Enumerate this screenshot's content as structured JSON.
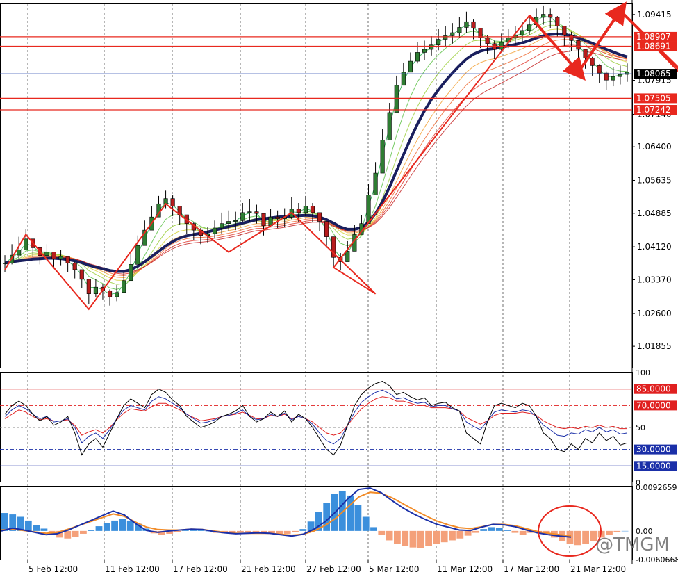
{
  "watermark": "@TMGM",
  "x_labels": [
    "5 Feb 12:00",
    "11 Feb 12:00",
    "17 Feb 12:00",
    "21 Feb 12:00",
    "27 Feb 12:00",
    "5 Mar 12:00",
    "11 Mar 12:00",
    "17 Mar 12:00",
    "21 Mar 12:00"
  ],
  "price_ticks": [
    "1.09415",
    "1.07915",
    "1.07140",
    "1.06400",
    "1.05635",
    "1.04885",
    "1.04120",
    "1.03370",
    "1.02600",
    "1.01855"
  ],
  "levels": {
    "red": [
      "1.08907",
      "1.08691",
      "1.07505",
      "1.07242"
    ],
    "current": "1.08065"
  },
  "rsi_ticks": [
    "100",
    "50",
    "0"
  ],
  "rsi_levels": {
    "red": [
      "85.0000",
      "70.0000"
    ],
    "blue": [
      "30.0000",
      "15.0000"
    ]
  },
  "macd_ticks": [
    "0.0092659",
    "0.00",
    "-0.0060668"
  ],
  "colors": {
    "up_candle": "#2e7d32",
    "down_candle": "#b71c1c",
    "ma_thick": "#1a1f5e",
    "annotation": "#e8281e",
    "hist_pos": "#3b8fdc",
    "hist_neg": "#f4a07a",
    "macd_line": "#1a2fa8",
    "signal_line": "#f28c28",
    "grid": "#000000",
    "background": "#ffffff"
  },
  "chart_data": {
    "type": "candlestick",
    "price_panel": {
      "ylim": [
        1.0135,
        1.0965
      ],
      "candles": {
        "close": [
          1.0375,
          1.0393,
          1.0405,
          1.043,
          1.041,
          1.0392,
          1.04,
          1.0385,
          1.039,
          1.0375,
          1.036,
          1.0338,
          1.0305,
          1.032,
          1.0312,
          1.0298,
          1.0308,
          1.0335,
          1.0372,
          1.0415,
          1.045,
          1.048,
          1.051,
          1.0522,
          1.0505,
          1.0485,
          1.0465,
          1.045,
          1.0438,
          1.0442,
          1.0455,
          1.0465,
          1.047,
          1.0472,
          1.049,
          1.0492,
          1.0488,
          1.046,
          1.048,
          1.0476,
          1.048,
          1.0498,
          1.049,
          1.0505,
          1.049,
          1.047,
          1.0435,
          1.0388,
          1.0378,
          1.0402,
          1.044,
          1.0465,
          1.053,
          1.058,
          1.0655,
          1.0718,
          1.078,
          1.081,
          1.0835,
          1.0855,
          1.0862,
          1.0872,
          1.0885,
          1.0893,
          1.09,
          1.0912,
          1.0925,
          1.091,
          1.0888,
          1.0875,
          1.0862,
          1.0878,
          1.0888,
          1.0895,
          1.0905,
          1.0918,
          1.0935,
          1.0942,
          1.0935,
          1.0915,
          1.0895,
          1.0882,
          1.0862,
          1.0842,
          1.0825,
          1.0808,
          1.0792,
          1.08,
          1.0805,
          1.081
        ],
        "high": [
          1.0393,
          1.0418,
          1.0435,
          1.0452,
          1.0428,
          1.0405,
          1.0418,
          1.04,
          1.0405,
          1.039,
          1.0378,
          1.0355,
          1.0325,
          1.0338,
          1.0328,
          1.0315,
          1.0325,
          1.0355,
          1.0395,
          1.0438,
          1.0472,
          1.0505,
          1.0528,
          1.054,
          1.053,
          1.0505,
          1.0485,
          1.0468,
          1.0455,
          1.0458,
          1.0472,
          1.049,
          1.0495,
          1.0492,
          1.0512,
          1.052,
          1.0508,
          1.0485,
          1.0498,
          1.0495,
          1.05,
          1.0525,
          1.0512,
          1.0528,
          1.0512,
          1.049,
          1.0458,
          1.041,
          1.0398,
          1.0425,
          1.0462,
          1.0485,
          1.0555,
          1.0605,
          1.068,
          1.074,
          1.0802,
          1.0832,
          1.0855,
          1.0878,
          1.0882,
          1.0892,
          1.0908,
          1.0915,
          1.0922,
          1.0935,
          1.0948,
          1.093,
          1.091,
          1.0895,
          1.0882,
          1.0898,
          1.0908,
          1.0915,
          1.0925,
          1.0938,
          1.0955,
          1.0962,
          1.0955,
          1.0938,
          1.0915,
          1.0902,
          1.0882,
          1.0862,
          1.0845,
          1.0828,
          1.0812,
          1.0822,
          1.0825,
          1.083
        ],
        "low": [
          1.0355,
          1.0372,
          1.0382,
          1.0408,
          1.0388,
          1.0372,
          1.038,
          1.0365,
          1.037,
          1.0355,
          1.034,
          1.0318,
          1.0282,
          1.0298,
          1.0292,
          1.0278,
          1.0288,
          1.0315,
          1.035,
          1.0395,
          1.0428,
          1.0458,
          1.0488,
          1.05,
          1.0482,
          1.0462,
          1.0442,
          1.0428,
          1.0418,
          1.0422,
          1.0432,
          1.0442,
          1.0448,
          1.045,
          1.0468,
          1.047,
          1.0465,
          1.0438,
          1.0458,
          1.0455,
          1.0458,
          1.0475,
          1.0468,
          1.0482,
          1.0468,
          1.0448,
          1.041,
          1.0365,
          1.0358,
          1.038,
          1.0418,
          1.0442,
          1.0505,
          1.0555,
          1.063,
          1.0692,
          1.0755,
          1.0785,
          1.081,
          1.083,
          1.0838,
          1.0848,
          1.086,
          1.0868,
          1.0875,
          1.0888,
          1.09,
          1.0885,
          1.0865,
          1.0852,
          1.084,
          1.0855,
          1.0865,
          1.0872,
          1.088,
          1.0895,
          1.091,
          1.0918,
          1.091,
          1.089,
          1.087,
          1.0858,
          1.0838,
          1.0818,
          1.0802,
          1.0785,
          1.077,
          1.0778,
          1.0782,
          1.0788
        ]
      },
      "ma_thick": [
        1.0375,
        1.0378,
        1.038,
        1.0382,
        1.0384,
        1.0385,
        1.0386,
        1.0386,
        1.0385,
        1.0383,
        1.038,
        1.0376,
        1.037,
        1.0366,
        1.0362,
        1.0358,
        1.0356,
        1.0356,
        1.036,
        1.0368,
        1.0378,
        1.039,
        1.0402,
        1.0414,
        1.0424,
        1.0432,
        1.0437,
        1.044,
        1.0443,
        1.0446,
        1.045,
        1.0454,
        1.0458,
        1.0462,
        1.0466,
        1.047,
        1.0474,
        1.0476,
        1.0478,
        1.048,
        1.0481,
        1.0482,
        1.0483,
        1.0484,
        1.0483,
        1.048,
        1.0474,
        1.0466,
        1.0457,
        1.0452,
        1.0452,
        1.0456,
        1.0468,
        1.0488,
        1.0515,
        1.0548,
        1.0585,
        1.0622,
        1.0658,
        1.0692,
        1.0722,
        1.0748,
        1.077,
        1.079,
        1.0808,
        1.0825,
        1.084,
        1.0851,
        1.0858,
        1.0862,
        1.0864,
        1.0867,
        1.087,
        1.0873,
        1.0877,
        1.0882,
        1.0888,
        1.0893,
        1.0896,
        1.0897,
        1.0896,
        1.0893,
        1.0888,
        1.0882,
        1.0876,
        1.0869,
        1.0862,
        1.0856,
        1.085,
        1.0845
      ],
      "annotation_zigzag": [
        [
          0,
          1.036
        ],
        [
          3,
          1.044
        ],
        [
          12,
          1.027
        ],
        [
          23,
          1.051
        ],
        [
          32,
          1.04
        ],
        [
          41,
          1.049
        ],
        [
          53,
          1.0305
        ],
        [
          47,
          1.0365
        ],
        [
          75,
          1.0939
        ],
        [
          82,
          1.0813
        ],
        [
          88,
          1.095
        ],
        [
          100,
          1.075
        ]
      ],
      "annotation_arrows": [
        [
          [
            75,
            1.0939
          ],
          [
            82,
            1.081
          ]
        ],
        [
          [
            82,
            1.081
          ],
          [
            88,
            1.095
          ]
        ],
        [
          [
            88,
            1.095
          ],
          [
            101,
            1.0745
          ]
        ],
        [
          [
            101,
            1.0745
          ],
          [
            104,
            1.0805
          ]
        ],
        [
          [
            104,
            1.0805
          ],
          [
            107,
            1.0755
          ]
        ]
      ]
    },
    "rsi_panel": {
      "ylim": [
        0,
        100
      ],
      "rsi_fast": [
        62,
        70,
        74,
        70,
        62,
        56,
        60,
        52,
        55,
        60,
        45,
        25,
        35,
        40,
        32,
        45,
        58,
        70,
        76,
        72,
        68,
        80,
        85,
        82,
        75,
        70,
        60,
        55,
        50,
        52,
        55,
        60,
        62,
        65,
        70,
        60,
        55,
        58,
        64,
        60,
        65,
        55,
        62,
        58,
        50,
        40,
        30,
        25,
        34,
        52,
        70,
        80,
        86,
        90,
        92,
        88,
        80,
        82,
        78,
        75,
        77,
        70,
        72,
        73,
        68,
        65,
        45,
        40,
        35,
        55,
        70,
        72,
        70,
        68,
        72,
        70,
        60,
        45,
        40,
        30,
        28,
        35,
        30,
        40,
        36,
        45,
        38,
        42,
        34,
        36
      ],
      "rsi_mid": [
        60,
        66,
        70,
        67,
        62,
        58,
        60,
        55,
        56,
        58,
        50,
        36,
        42,
        45,
        40,
        48,
        58,
        66,
        70,
        68,
        66,
        74,
        78,
        76,
        72,
        68,
        62,
        58,
        54,
        55,
        57,
        60,
        61,
        63,
        66,
        60,
        57,
        58,
        62,
        60,
        63,
        57,
        60,
        58,
        53,
        45,
        38,
        35,
        40,
        52,
        64,
        73,
        78,
        82,
        84,
        81,
        76,
        77,
        74,
        72,
        73,
        69,
        70,
        70,
        67,
        65,
        55,
        51,
        48,
        56,
        64,
        66,
        65,
        64,
        66,
        65,
        60,
        52,
        48,
        43,
        42,
        45,
        44,
        48,
        46,
        50,
        46,
        48,
        44,
        45
      ],
      "rsi_slow": [
        58,
        62,
        66,
        64,
        60,
        57,
        58,
        56,
        56,
        57,
        52,
        43,
        46,
        48,
        45,
        50,
        57,
        63,
        67,
        66,
        65,
        69,
        72,
        72,
        69,
        66,
        62,
        59,
        56,
        57,
        58,
        60,
        61,
        62,
        64,
        61,
        58,
        58,
        61,
        60,
        62,
        58,
        60,
        58,
        55,
        50,
        45,
        43,
        45,
        52,
        60,
        67,
        72,
        76,
        78,
        77,
        74,
        74,
        72,
        70,
        70,
        68,
        68,
        68,
        67,
        65,
        59,
        56,
        53,
        56,
        61,
        63,
        63,
        63,
        64,
        63,
        61,
        56,
        53,
        50,
        49,
        50,
        49,
        51,
        50,
        52,
        50,
        51,
        49,
        49
      ]
    },
    "macd_panel": {
      "ylim": [
        -0.0062,
        0.0094
      ],
      "histogram": [
        0.0038,
        0.0035,
        0.003,
        0.0022,
        0.0012,
        0.0005,
        -0.0008,
        -0.0014,
        -0.0016,
        -0.0012,
        -0.0006,
        0.0002,
        0.001,
        0.0016,
        0.0022,
        0.0025,
        0.0022,
        0.0015,
        0.0005,
        -0.0005,
        -0.0008,
        -0.0006,
        -0.0002,
        0.0002,
        0.0004,
        0.0003,
        0,
        -0.0004,
        -0.0005,
        -0.0004,
        -0.0002,
        -0.0002,
        -0.0003,
        -0.0004,
        -0.0006,
        -0.0008,
        -0.0006,
        -0.0002,
        0.0004,
        0.002,
        0.004,
        0.006,
        0.0078,
        0.0085,
        0.0075,
        0.0055,
        0.003,
        0.0008,
        -0.0008,
        -0.002,
        -0.0028,
        -0.0032,
        -0.0035,
        -0.0036,
        -0.0032,
        -0.0028,
        -0.0024,
        -0.002,
        -0.0016,
        -0.001,
        -0.0004,
        0.0004,
        0.0008,
        0.0006,
        0.0002,
        -0.0004,
        -0.0008,
        -0.0004,
        -0.0002,
        -0.0006,
        -0.0014,
        -0.0022,
        -0.0028,
        -0.003,
        -0.0028,
        -0.0022,
        -0.0014,
        -0.0008,
        -0.0002,
        0
      ],
      "macd": [
        0,
        0.0006,
        0.0002,
        -0.0003,
        -0.0008,
        -0.0006,
        0.0002,
        0.0012,
        0.0022,
        0.0032,
        0.0042,
        0.0034,
        0.0016,
        0.0001,
        -0.0003,
        0,
        0.0002,
        0.0004,
        0.0003,
        -0.0001,
        -0.0004,
        -0.0006,
        -0.0005,
        -0.0004,
        -0.0005,
        -0.0008,
        -0.0011,
        -0.0007,
        0.0004,
        0.002,
        0.0042,
        0.0068,
        0.0088,
        0.0091,
        0.0081,
        0.0064,
        0.0048,
        0.0035,
        0.0024,
        0.0014,
        0.0008,
        0.0002,
        0.0001,
        0.0008,
        0.0014,
        0.0013,
        0.0009,
        0.0002,
        -0.0004,
        -0.0008,
        -0.0011,
        -0.0013
      ],
      "signal": [
        0.0002,
        0.0004,
        0.0001,
        -0.0002,
        -0.0005,
        -0.0003,
        0.0004,
        0.0012,
        0.002,
        0.0028,
        0.0036,
        0.0031,
        0.0019,
        0.0008,
        0.0003,
        0.0002,
        0.0002,
        0.0004,
        0.0003,
        0,
        -0.0003,
        -0.0005,
        -0.0005,
        -0.0005,
        -0.0005,
        -0.0007,
        -0.0009,
        -0.0007,
        0,
        0.0012,
        0.0028,
        0.005,
        0.0072,
        0.0082,
        0.008,
        0.007,
        0.0057,
        0.0044,
        0.0032,
        0.0021,
        0.0013,
        0.0007,
        0.0005,
        0.0009,
        0.0014,
        0.0014,
        0.0011,
        0.0005,
        -0.0001,
        -0.0005,
        -0.0008,
        -0.001
      ]
    }
  }
}
